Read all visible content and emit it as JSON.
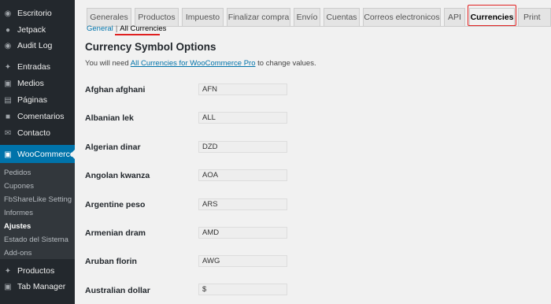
{
  "sidebar": {
    "top_items": [
      {
        "label": "Escritorio",
        "icon": "dashboard-icon"
      },
      {
        "label": "Jetpack",
        "icon": "jetpack-icon"
      },
      {
        "label": "Audit Log",
        "icon": "audit-log-icon"
      },
      {
        "label": "Entradas",
        "icon": "pin-icon"
      },
      {
        "label": "Medios",
        "icon": "media-icon"
      },
      {
        "label": "Páginas",
        "icon": "pages-icon"
      },
      {
        "label": "Comentarios",
        "icon": "comments-icon"
      },
      {
        "label": "Contacto",
        "icon": "mail-icon"
      },
      {
        "label": "WooCommerce",
        "icon": "woo-icon"
      }
    ],
    "sub_items": [
      "Pedidos",
      "Cupones",
      "FbShareLike Setting",
      "Informes",
      "Ajustes",
      "Estado del Sistema",
      "Add-ons"
    ],
    "current_sub": "Ajustes",
    "bottom_items": [
      {
        "label": "Productos",
        "icon": "pin-icon"
      },
      {
        "label": "Tab Manager",
        "icon": "tab-manager-icon"
      }
    ]
  },
  "tabs": [
    "Generales",
    "Productos",
    "Impuesto",
    "Finalizar compra",
    "Envío",
    "Cuentas",
    "Correos electronicos",
    "API",
    "Currencies",
    "Print"
  ],
  "active_tab": "Currencies",
  "subnav": {
    "general": "General",
    "separator": "|",
    "current": "All Currencies"
  },
  "page_title": "Currency Symbol Options",
  "notice": {
    "before": "You will need ",
    "link": "All Currencies for WooCommerce Pro",
    "after": " to change values."
  },
  "currencies": [
    {
      "name": "Afghan afghani",
      "symbol": "AFN"
    },
    {
      "name": "Albanian lek",
      "symbol": "ALL"
    },
    {
      "name": "Algerian dinar",
      "symbol": "DZD"
    },
    {
      "name": "Angolan kwanza",
      "symbol": "AOA"
    },
    {
      "name": "Argentine peso",
      "symbol": "ARS"
    },
    {
      "name": "Armenian dram",
      "symbol": "AMD"
    },
    {
      "name": "Aruban florin",
      "symbol": "AWG"
    },
    {
      "name": "Australian dollar",
      "symbol": "$"
    }
  ],
  "colors": {
    "sidebar_bg": "#23282d",
    "active_menu": "#0073aa",
    "link": "#0073aa",
    "highlight": "#e02020"
  }
}
